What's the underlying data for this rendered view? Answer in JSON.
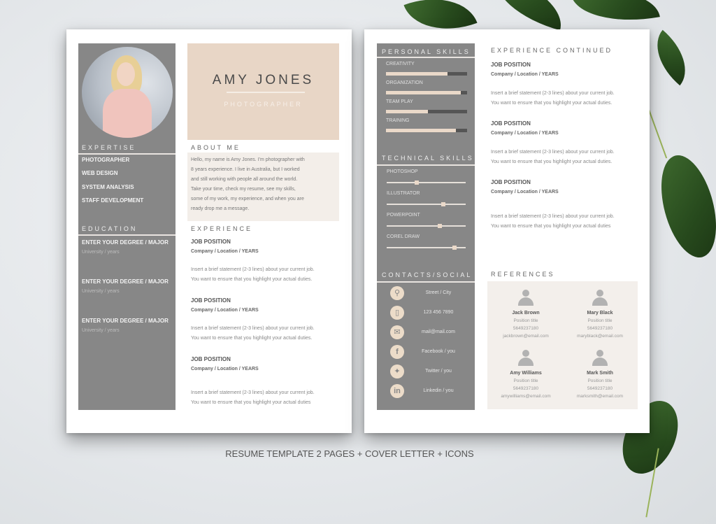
{
  "caption": "RESUME TEMPLATE 2 PAGES + COVER LETTER + ICONS",
  "page1": {
    "name": "AMY JONES",
    "profession": "PHOTOGRAPHER",
    "expertise": {
      "title": "EXPERTISE",
      "items": [
        "PHOTOGRAPHER",
        "WEB DESIGN",
        "SYSTEM ANALYSIS",
        "STAFF DEVELOPMENT"
      ]
    },
    "education": {
      "title": "EDUCATION",
      "items": [
        {
          "degree": "ENTER YOUR DEGREE / MAJOR",
          "school": "University / years"
        },
        {
          "degree": "ENTER YOUR DEGREE / MAJOR",
          "school": "University / years"
        },
        {
          "degree": "ENTER YOUR DEGREE / MAJOR",
          "school": "University / years"
        }
      ]
    },
    "about": {
      "title": "ABOUT ME",
      "lines": [
        "Hello, my name is Amy Jones. I'm photographer with",
        "8 years experience. I live in Australia, but I worked",
        "and still working with people all around the world.",
        "Take your time, check my resume, see my skills,",
        "some of my work, my experience, and when you are",
        "ready drop me a message."
      ]
    },
    "experience": {
      "title": "EXPERIENCE",
      "jobs": [
        {
          "position": "JOB POSITION",
          "company": "Company / Location / YEARS",
          "desc1": "Insert a brief statement (2-3 lines) about your current job.",
          "desc2": "You want to ensure that you highlight your actual duties."
        },
        {
          "position": "JOB POSITION",
          "company": "Company / Location / YEARS",
          "desc1": "Insert a brief statement (2-3 lines) about your current job.",
          "desc2": "You want to ensure that you highlight your actual duties."
        },
        {
          "position": "JOB POSITION",
          "company": "Company / Location / YEARS",
          "desc1": "Insert a brief statement (2-3 lines) about your current job.",
          "desc2": "You want to ensure that you highlight your actual duties"
        }
      ]
    }
  },
  "page2": {
    "personal_skills": {
      "title": "PERSONAL SKILLS",
      "items": [
        {
          "label": "CREATIVITY",
          "level": 0.76
        },
        {
          "label": "ORGANIZATION",
          "level": 0.92
        },
        {
          "label": "TEAM PLAY",
          "level": 0.52
        },
        {
          "label": "TRAINING",
          "level": 0.86
        }
      ]
    },
    "technical_skills": {
      "title": "TECHNICAL SKILLS",
      "items": [
        {
          "label": "PHOTOSHOP",
          "level": 0.38
        },
        {
          "label": "ILLUSTRATOR",
          "level": 0.72
        },
        {
          "label": "POWERPOINT",
          "level": 0.67
        },
        {
          "label": "COREL DRAW",
          "level": 0.86
        }
      ]
    },
    "contacts": {
      "title": "CONTACTS/SOCIAL",
      "items": [
        {
          "icon": "location-pin-icon",
          "glyph": "⚲",
          "text": "Street / City"
        },
        {
          "icon": "phone-icon",
          "glyph": "▯",
          "text": "123 456 7890"
        },
        {
          "icon": "mail-icon",
          "glyph": "✉",
          "text": "mail@mail.com"
        },
        {
          "icon": "facebook-icon",
          "glyph": "f",
          "text": "Facebook / you"
        },
        {
          "icon": "twitter-icon",
          "glyph": "✦",
          "text": "Twitter / you"
        },
        {
          "icon": "linkedin-icon",
          "glyph": "in",
          "text": "Linkedin / you"
        }
      ]
    },
    "experience_continued": {
      "title": "EXPERIENCE CONTINUED",
      "jobs": [
        {
          "position": "JOB POSITION",
          "company": "Company / Location / YEARS",
          "desc1": "Insert a brief statement (2-3 lines) about your current job.",
          "desc2": "You want to ensure that you highlight your actual duties."
        },
        {
          "position": "JOB POSITION",
          "company": "Company / Location / YEARS",
          "desc1": "Insert a brief statement (2-3 lines) about your current job.",
          "desc2": "You want to ensure that you highlight your actual duties."
        },
        {
          "position": "JOB POSITION",
          "company": "Company / Location / YEARS",
          "desc1": "Insert a brief statement (2-3 lines) about your current job.",
          "desc2": "You want to ensure that you highlight your actual duties"
        }
      ]
    },
    "references": {
      "title": "REFERENCES",
      "people": [
        {
          "name": "Jack Brown",
          "title": "Position title",
          "phone": "5649237180",
          "email": "jackbrown@email.com"
        },
        {
          "name": "Mary Black",
          "title": "Position title",
          "phone": "5649237180",
          "email": "maryblack@email.com"
        },
        {
          "name": "Amy Williams",
          "title": "Position title",
          "phone": "5649237180",
          "email": "amywilliams@email.com"
        },
        {
          "name": "Mark Smith",
          "title": "Position title",
          "phone": "5649237180",
          "email": "marksmith@email.com"
        }
      ]
    }
  }
}
